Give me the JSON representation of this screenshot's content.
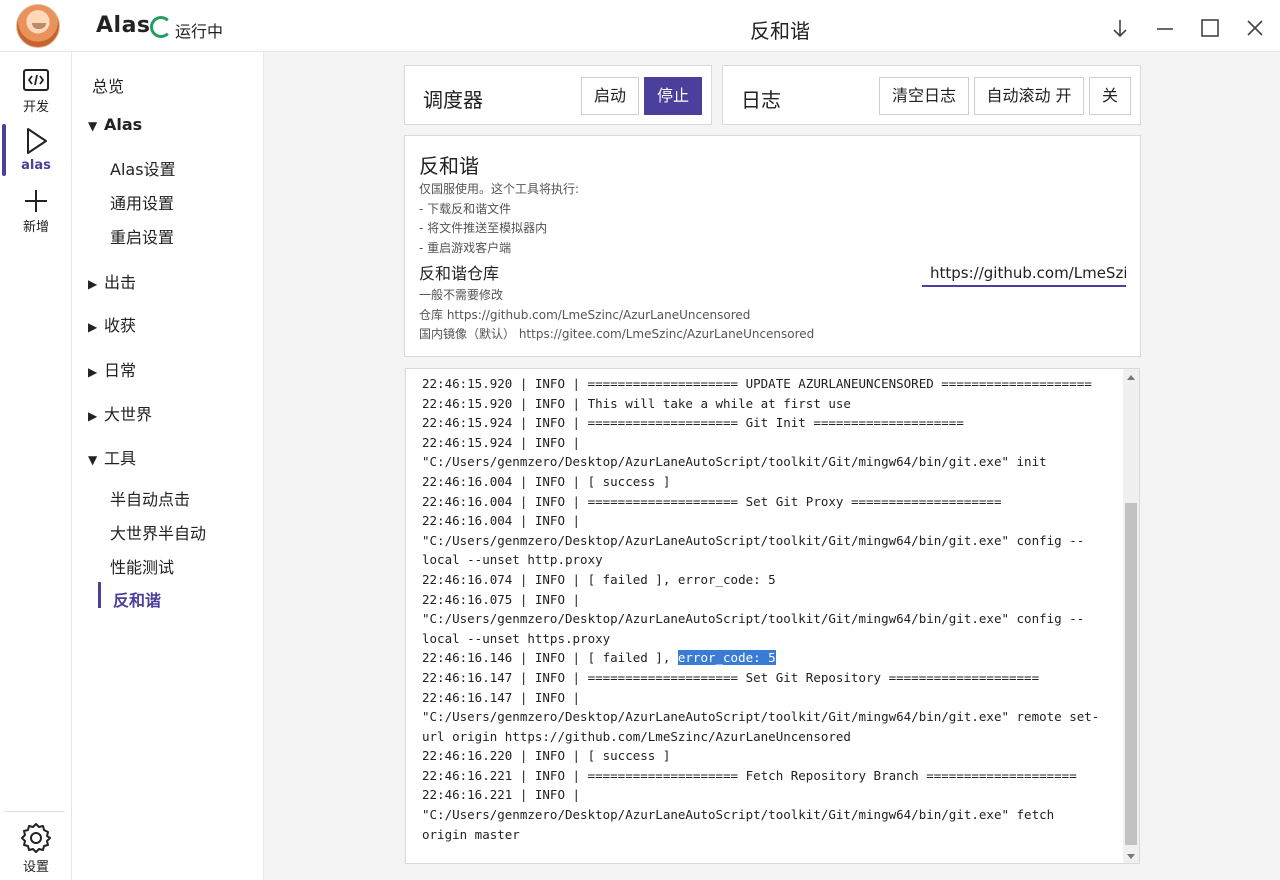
{
  "titlebar": {
    "app_name": "Alas",
    "status": "运行中",
    "window_title": "反和谐"
  },
  "rail": {
    "items": [
      {
        "label": "开发",
        "icon": "code-icon"
      },
      {
        "label": "alas",
        "icon": "play-icon"
      },
      {
        "label": "新增",
        "icon": "plus-icon"
      }
    ],
    "settings_label": "设置"
  },
  "menu": {
    "overview": "总览",
    "alas_group": "Alas",
    "alas_items": [
      "Alas设置",
      "通用设置",
      "重启设置"
    ],
    "groups": [
      "出击",
      "收获",
      "日常",
      "大世界"
    ],
    "tools_group": "工具",
    "tools_items": [
      "半自动点击",
      "大世界半自动",
      "性能测试",
      "反和谐"
    ]
  },
  "scheduler": {
    "title": "调度器",
    "start_label": "启动",
    "stop_label": "停止"
  },
  "logpanel": {
    "title": "日志",
    "clear_label": "清空日志",
    "autoscroll_label": "自动滚动 开",
    "off_label": "关"
  },
  "tool": {
    "title": "反和谐",
    "desc": [
      "仅国服使用。这个工具将执行:",
      "- 下载反和谐文件",
      "- 将文件推送至模拟器内",
      "- 重启游戏客户端"
    ],
    "repo_title": "反和谐仓库",
    "repo_help": [
      "一般不需要修改",
      "仓库 https://github.com/LmeSzinc/AzurLaneUncensored",
      "国内镜像（默认） https://gitee.com/LmeSzinc/AzurLaneUncensored"
    ],
    "repo_value": "https://github.com/LmeSzinc/AzurLaneUncensored"
  },
  "log_lines": [
    "22:46:15.920 | INFO | ==================== UPDATE AZURLANEUNCENSORED ====================",
    "22:46:15.920 | INFO | This will take a while at first use",
    "22:46:15.924 | INFO | ==================== Git Init ====================",
    "22:46:15.924 | INFO |",
    "\"C:/Users/genmzero/Desktop/AzurLaneAutoScript/toolkit/Git/mingw64/bin/git.exe\" init",
    "22:46:16.004 | INFO | [ success ]",
    "22:46:16.004 | INFO | ==================== Set Git Proxy ====================",
    "22:46:16.004 | INFO |",
    "\"C:/Users/genmzero/Desktop/AzurLaneAutoScript/toolkit/Git/mingw64/bin/git.exe\" config --",
    "local --unset http.proxy",
    "22:46:16.074 | INFO | [ failed ], error_code: 5",
    "22:46:16.075 | INFO |",
    "\"C:/Users/genmzero/Desktop/AzurLaneAutoScript/toolkit/Git/mingw64/bin/git.exe\" config --",
    "local --unset https.proxy",
    "22:46:16.146 | INFO | [ failed ], ",
    "22:46:16.147 | INFO | ==================== Set Git Repository ====================",
    "22:46:16.147 | INFO |",
    "\"C:/Users/genmzero/Desktop/AzurLaneAutoScript/toolkit/Git/mingw64/bin/git.exe\" remote set-",
    "url origin https://github.com/LmeSzinc/AzurLaneUncensored",
    "22:46:16.220 | INFO | [ success ]",
    "22:46:16.221 | INFO | ==================== Fetch Repository Branch ====================",
    "22:46:16.221 | INFO |",
    "\"C:/Users/genmzero/Desktop/AzurLaneAutoScript/toolkit/Git/mingw64/bin/git.exe\" fetch",
    "origin master"
  ],
  "log_selection": "error_code: 5",
  "colors": {
    "accent": "#4a3f9a",
    "running": "#20a060",
    "selection": "#3a7bd5"
  }
}
